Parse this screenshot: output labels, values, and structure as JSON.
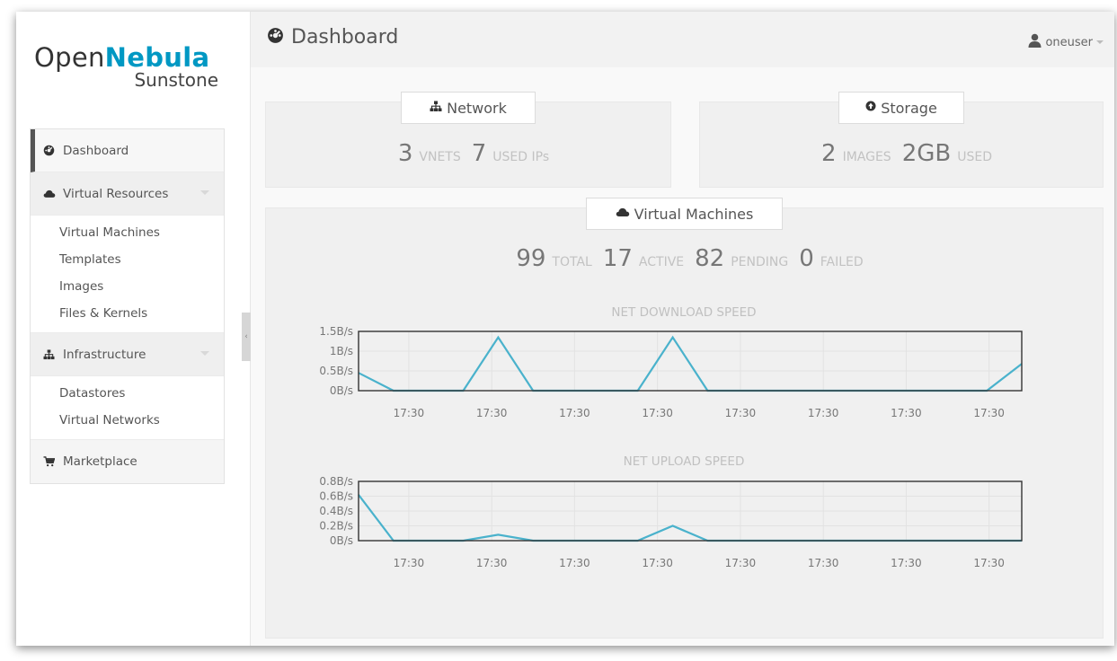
{
  "app": {
    "logo_open": "Open",
    "logo_nebula": "Nebula",
    "logo_sunstone": "Sunstone"
  },
  "sidebar": {
    "dashboard": "Dashboard",
    "virtual_resources": "Virtual Resources",
    "virtual_items": [
      "Virtual Machines",
      "Templates",
      "Images",
      "Files & Kernels"
    ],
    "infrastructure": "Infrastructure",
    "infra_items": [
      "Datastores",
      "Virtual Networks"
    ],
    "marketplace": "Marketplace",
    "collapse_glyph": "‹"
  },
  "header": {
    "title": "Dashboard",
    "user": "oneuser"
  },
  "network": {
    "title": "Network",
    "vnets_count": "3",
    "vnets_label": "VNETS",
    "ips_count": "7",
    "ips_label": "USED IPs"
  },
  "storage": {
    "title": "Storage",
    "images_count": "2",
    "images_label": "IMAGES",
    "used_count": "2GB",
    "used_label": "USED"
  },
  "vms": {
    "title": "Virtual Machines",
    "total_count": "99",
    "total_label": "TOTAL",
    "active_count": "17",
    "active_label": "ACTIVE",
    "pending_count": "82",
    "pending_label": "PENDING",
    "failed_count": "0",
    "failed_label": "FAILED"
  },
  "colors": {
    "accent": "#0098c3",
    "line": "#4ab2cc"
  },
  "chart_data": [
    {
      "type": "line",
      "title": "NET DOWNLOAD SPEED",
      "ylim": [
        0,
        1.5
      ],
      "yticks": [
        "1.5B/s",
        "1B/s",
        "0.5B/s",
        "0B/s"
      ],
      "xticks": [
        "17:30",
        "17:30",
        "17:30",
        "17:30",
        "17:30",
        "17:30",
        "17:30",
        "17:30"
      ],
      "values": [
        0.45,
        0,
        0,
        0,
        1.35,
        0,
        0,
        0,
        0,
        1.35,
        0,
        0,
        0,
        0,
        0,
        0,
        0,
        0,
        0,
        0.68
      ],
      "grid": true
    },
    {
      "type": "line",
      "title": "NET UPLOAD SPEED",
      "ylim": [
        0,
        0.8
      ],
      "yticks": [
        "0.8B/s",
        "0.6B/s",
        "0.4B/s",
        "0.2B/s",
        "0B/s"
      ],
      "xticks": [
        "17:30",
        "17:30",
        "17:30",
        "17:30",
        "17:30",
        "17:30",
        "17:30",
        "17:30"
      ],
      "values": [
        0.62,
        0,
        0,
        0,
        0.08,
        0,
        0,
        0,
        0,
        0.2,
        0,
        0,
        0,
        0,
        0,
        0,
        0,
        0,
        0,
        0
      ],
      "grid": true
    }
  ]
}
